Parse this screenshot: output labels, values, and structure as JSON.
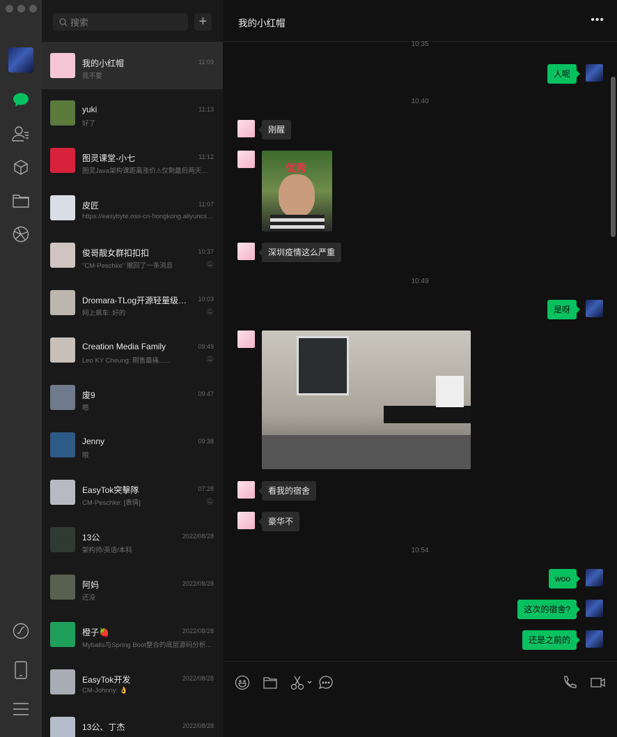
{
  "search": {
    "placeholder": "搜索"
  },
  "chats": [
    {
      "name": "我的小红帽",
      "time": "11:03",
      "preview": "我不要",
      "selected": true,
      "color": "#f6c6d6"
    },
    {
      "name": "yuki",
      "time": "11:13",
      "preview": "好了",
      "color": "#5b7a3c"
    },
    {
      "name": "图灵课堂-小七",
      "time": "11:12",
      "preview": "图灵Java架构课距离涨价⚠仅剩最后两天！😭",
      "color": "#d8213a"
    },
    {
      "name": "皮匠",
      "time": "11:07",
      "preview": "https://easybyte.oss-cn-hongkong.aliyuncs.com",
      "color": "#d9dde6"
    },
    {
      "name": "俊哥靓女群扣扣扣",
      "time": "10:37",
      "preview": "\"CM-Peschke\" 撤回了一条消息",
      "muted": true,
      "color": "#cfc4c0"
    },
    {
      "name": "Dromara-TLog开源轻量级日志追踪",
      "time": "10:03",
      "preview": "网上飙车: 好的",
      "muted": true,
      "color": "#bdb6ae"
    },
    {
      "name": "Creation Media Family",
      "time": "09:49",
      "preview": "Leo KY Cheung: 剛售最痛......",
      "muted": true,
      "color": "#c7bfb8"
    },
    {
      "name": "废9",
      "time": "09:47",
      "preview": "嗯",
      "color": "#6f7a8c"
    },
    {
      "name": "Jenny",
      "time": "09:38",
      "preview": "哦",
      "color": "#2d5a86"
    },
    {
      "name": "EasyTok突擊隊",
      "time": "07:28",
      "preview": "CM-Peschke: [表情]",
      "muted": true,
      "color": "#b9b9c4"
    },
    {
      "name": "13公",
      "time": "2022/08/28",
      "preview": "架构师/英语/本科",
      "color": "#2f3a33"
    },
    {
      "name": "阿妈",
      "time": "2022/08/28",
      "preview": "还没",
      "color": "#58614f"
    },
    {
      "name": "橙子🍓",
      "time": "2022/08/28",
      "preview": "Mybatis与Spring Boot整合的底层源码分析...",
      "color": "#1fa05a"
    },
    {
      "name": "EasyTok开发",
      "time": "2022/08/28",
      "preview": "CM-Johnny: 👌",
      "color": "#a8acb4"
    },
    {
      "name": "13公、丁杰",
      "time": "2022/08/28",
      "preview": "",
      "color": "#b5bccb"
    }
  ],
  "conversation": {
    "title": "我的小红帽",
    "messages": [
      {
        "type": "time",
        "text": "10:35"
      },
      {
        "type": "text",
        "side": "right",
        "text": "人呢"
      },
      {
        "type": "time",
        "text": "10:40"
      },
      {
        "type": "text",
        "side": "left",
        "text": "刚醒"
      },
      {
        "type": "image",
        "side": "left",
        "caption": "优秀"
      },
      {
        "type": "text",
        "side": "left",
        "text": "深圳疫情这么严重"
      },
      {
        "type": "time",
        "text": "10:49"
      },
      {
        "type": "text",
        "side": "right",
        "text": "是呀"
      },
      {
        "type": "image",
        "side": "left"
      },
      {
        "type": "text",
        "side": "left",
        "text": "看我的宿舍"
      },
      {
        "type": "text",
        "side": "left",
        "text": "豪华不"
      },
      {
        "type": "time",
        "text": "10:54"
      },
      {
        "type": "text",
        "side": "right",
        "text": "woo"
      },
      {
        "type": "text",
        "side": "right",
        "text": "这次的宿舍?"
      },
      {
        "type": "text",
        "side": "right",
        "text": "还是之前的"
      }
    ]
  },
  "colors": {
    "accent": "#07c160",
    "sent_bubble": "#07c160",
    "received_bubble": "#2c2c2c"
  },
  "toolbar": {
    "icons": [
      "emoji-icon",
      "folder-icon",
      "scissors-icon",
      "chat-history-icon",
      "phone-icon",
      "video-icon"
    ]
  }
}
